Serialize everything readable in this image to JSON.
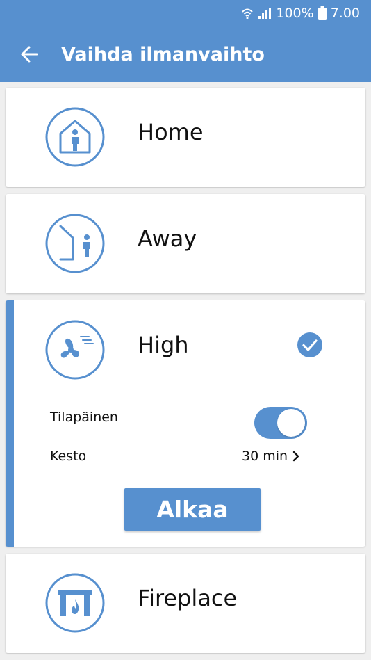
{
  "status_bar": {
    "battery_percent": "100%",
    "time": "7.00",
    "icons": [
      "wifi-icon",
      "signal-icon",
      "battery-icon"
    ]
  },
  "app_bar": {
    "title": "Vaihda ilmanvaihto",
    "back_icon": "arrow-left-icon"
  },
  "modes": [
    {
      "label": "Home",
      "icon": "house-person-icon"
    },
    {
      "label": "Away",
      "icon": "house-person-leaving-icon"
    },
    {
      "label": "High",
      "icon": "fan-icon",
      "selected": true
    },
    {
      "label": "Fireplace",
      "icon": "fireplace-icon"
    }
  ],
  "high_options": {
    "temporary_label": "Tilapäinen",
    "temporary_enabled": true,
    "duration_label": "Kesto",
    "duration_value": "30 min",
    "start_button": "Alkaa"
  },
  "colors": {
    "primary": "#5790cf",
    "background": "#efefef",
    "card": "#ffffff"
  }
}
